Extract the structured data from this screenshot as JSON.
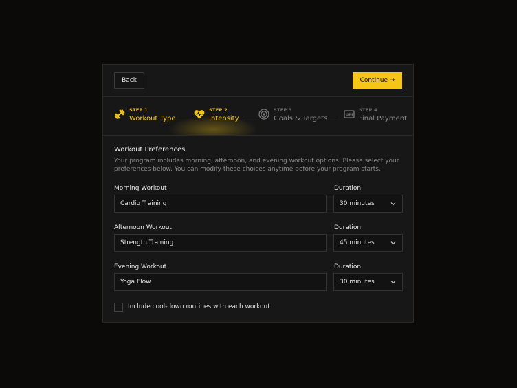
{
  "header": {
    "back_label": "Back",
    "continue_label": "Continue →"
  },
  "steps": [
    {
      "step": "STEP 1",
      "label": "Workout Type",
      "icon": "dumbbell-icon",
      "state": "done"
    },
    {
      "step": "STEP 2",
      "label": "Intensity",
      "icon": "heart-pulse-icon",
      "state": "active"
    },
    {
      "step": "STEP 3",
      "label": "Goals & Targets",
      "icon": "target-icon",
      "state": "upcoming"
    },
    {
      "step": "STEP 4",
      "label": "Final Payment",
      "icon": "payment-card-icon",
      "state": "upcoming"
    }
  ],
  "section": {
    "title": "Workout Preferences",
    "description": "Your program includes morning, afternoon, and evening workout options. Please select your preferences below. You can modify these choices anytime before your program starts."
  },
  "workouts": [
    {
      "label": "Morning Workout",
      "value": "Cardio Training",
      "duration_label": "Duration",
      "duration": "30 minutes"
    },
    {
      "label": "Afternoon Workout",
      "value": "Strength Training",
      "duration_label": "Duration",
      "duration": "45 minutes"
    },
    {
      "label": "Evening Workout",
      "value": "Yoga Flow",
      "duration_label": "Duration",
      "duration": "30 minutes"
    }
  ],
  "cooldown": {
    "label": "Include cool-down routines with each workout",
    "checked": false
  },
  "colors": {
    "accent": "#f5c518",
    "background": "#0b0a09",
    "card": "#171717"
  }
}
